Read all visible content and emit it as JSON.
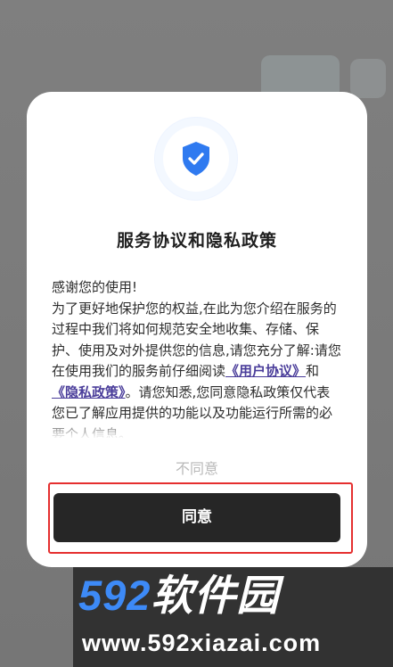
{
  "dialog": {
    "title": "服务协议和隐私政策",
    "greeting": "感谢您的使用!",
    "text_before_links": "为了更好地保护您的权益,在此为您介绍在服务的过程中我们将如何规范安全地收集、存储、保护、使用及对外提供您的信息,请您充分了解:请您在使用我们的服务前仔细阅读",
    "user_agreement_link": "《用户协议》",
    "and_text": "和",
    "privacy_policy_link": "《隐私政策》",
    "text_after_links": "。请您知悉,您同意隐私政策仅代表您已了解应用提供的功能以及功能运行所需的必要个人信息。",
    "decline_label": "不同意",
    "agree_label": "同意"
  },
  "watermark": {
    "brand_number": "592",
    "brand_name": "软件园",
    "url": "www.592xiazai.com"
  },
  "colors": {
    "primary_button": "#262626",
    "link": "#4a3d9a",
    "highlight": "#e52f2f",
    "shield": "#2f7af0"
  }
}
